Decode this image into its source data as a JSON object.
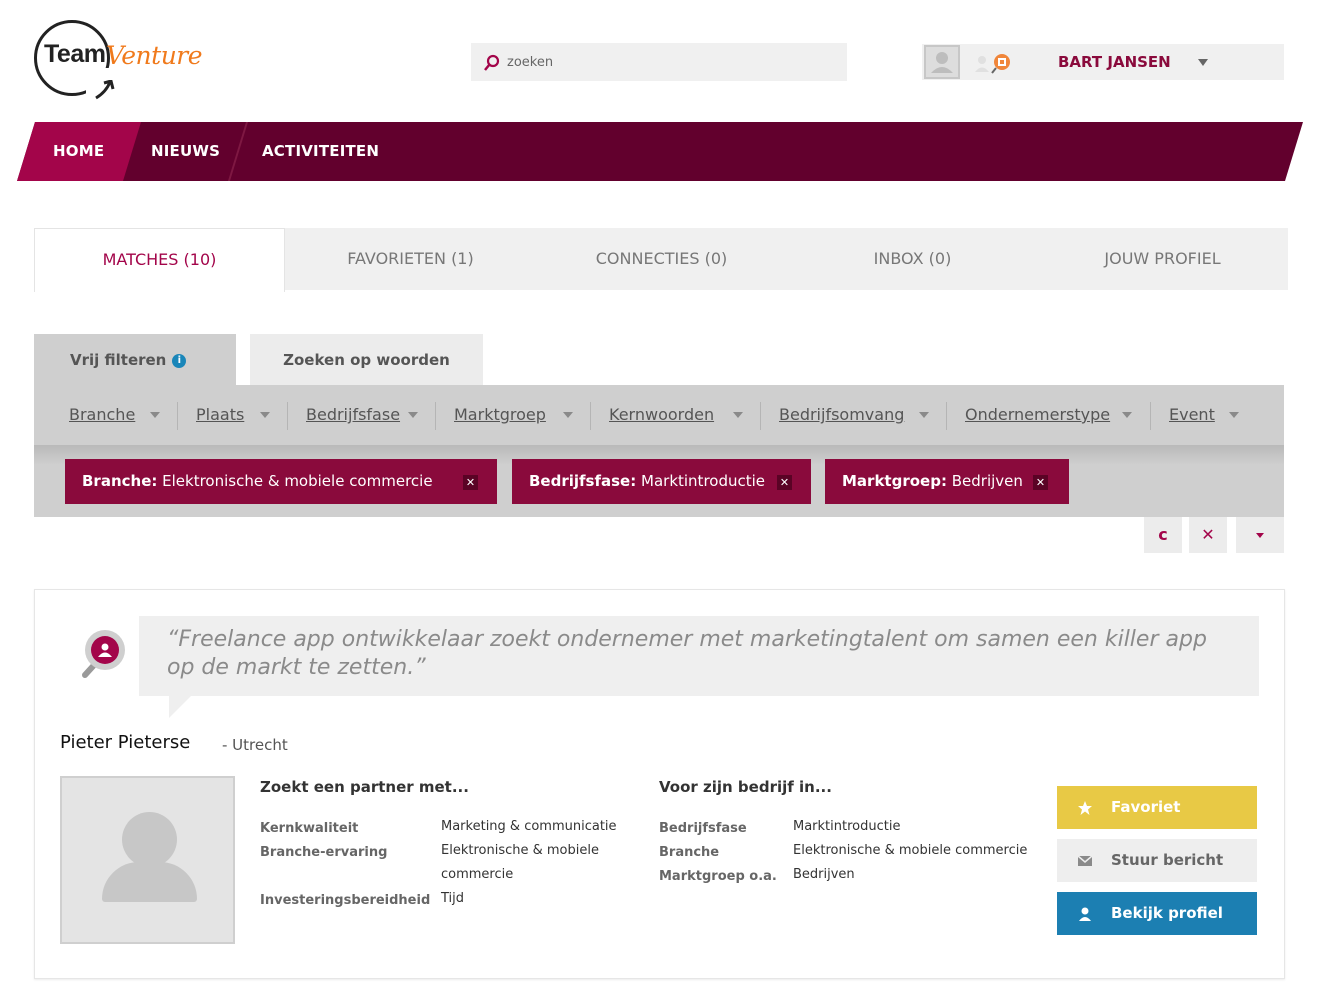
{
  "brand": {
    "team": "Team",
    "venture": "Venture"
  },
  "search": {
    "placeholder": "zoeken"
  },
  "user": {
    "name": "BART JANSEN"
  },
  "nav": [
    "HOME",
    "NIEUWS",
    "ACTIVITEITEN"
  ],
  "tabs": [
    "MATCHES (10)",
    "FAVORIETEN (1)",
    "CONNECTIES (0)",
    "INBOX (0)",
    "JOUW PROFIEL"
  ],
  "filter_tabs": {
    "free": "Vrij filteren",
    "words": "Zoeken op woorden",
    "info": "i"
  },
  "dropdowns": [
    "Branche",
    "Plaats",
    "Bedrijfsfase",
    "Marktgroep",
    "Kernwoorden",
    "Bedrijfsomvang",
    "Ondernemerstype",
    "Event"
  ],
  "chips": [
    {
      "key": "Branche:",
      "value": "Elektronische & mobiele commercie"
    },
    {
      "key": "Bedrijfsfase:",
      "value": "Marktintroductie"
    },
    {
      "key": "Marktgroep:",
      "value": "Bedrijven"
    }
  ],
  "chip_close": "✕",
  "small_buttons": {
    "refresh": "c",
    "clear": "✕"
  },
  "result": {
    "quote": "“Freelance app ontwikkelaar zoekt ondernemer met marketingtalent om samen een killer app op de markt te zetten.”",
    "name": "Pieter Pieterse",
    "city": "- Utrecht",
    "partner": {
      "title": "Zoekt een partner met...",
      "rows": [
        {
          "label": "Kernkwaliteit",
          "value": "Marketing & communicatie"
        },
        {
          "label": "Branche-ervaring",
          "value": "Elektronische & mobiele commercie"
        },
        {
          "label": "Investeringsbereidheid",
          "value": "Tijd"
        }
      ]
    },
    "company": {
      "title": "Voor zijn bedrijf in...",
      "rows": [
        {
          "label": "Bedrijfsfase",
          "value": "Marktintroductie"
        },
        {
          "label": "Branche",
          "value": "Elektronische & mobiele commercie"
        },
        {
          "label": "Marktgroep o.a.",
          "value": "Bedrijven"
        }
      ]
    },
    "actions": {
      "favorite": "Favoriet",
      "message": "Stuur bericht",
      "profile": "Bekijk profiel"
    }
  },
  "colors": {
    "brand_dark": "#62002d",
    "brand": "#a3054a",
    "chip": "#8a0a3c",
    "favorite": "#e8c945",
    "profile": "#1c7fb2",
    "logo_orange": "#f07a1c"
  }
}
